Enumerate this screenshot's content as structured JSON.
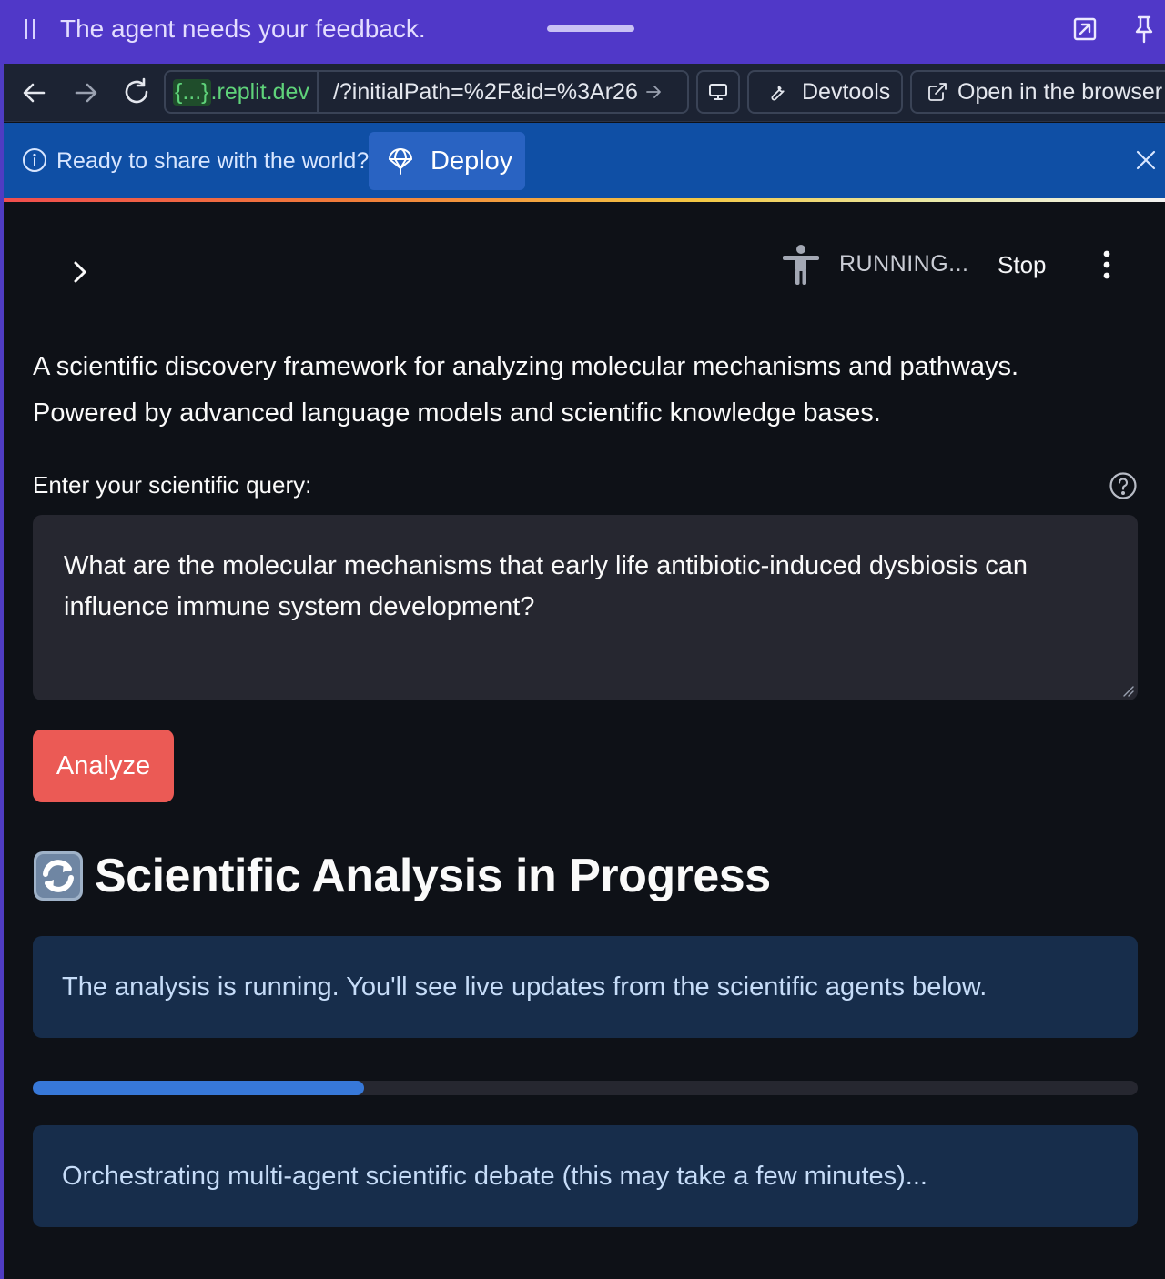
{
  "feedback_bar": {
    "message": "The agent needs your feedback."
  },
  "browser": {
    "url_braces": "{...}",
    "url_host": ".replit.dev",
    "url_path": "/?initialPath=%2F&id=%3Ar26",
    "devtools_label": "Devtools",
    "open_browser_label": "Open in the browser"
  },
  "deploy_banner": {
    "message": "Ready to share with the world?",
    "deploy_label": "Deploy"
  },
  "app": {
    "status": "RUNNING...",
    "stop_label": "Stop",
    "description_line1": "A scientific discovery framework for analyzing molecular mechanisms and pathways.",
    "description_line2": "Powered by advanced language models and scientific knowledge bases.",
    "query_label": "Enter your scientific query:",
    "query_value": "What are the molecular mechanisms that early life antibiotic-induced dysbiosis can influence immune system development?",
    "analyze_label": "Analyze",
    "progress_heading": "Scientific Analysis in Progress",
    "info_message": "The analysis is running. You'll see live updates from the scientific agents below.",
    "progress_fraction": 0.3,
    "status_message": "Orchestrating multi-agent scientific debate (this may take a few minutes)..."
  },
  "colors": {
    "feedback_bar": "#5038c8",
    "deploy_banner": "#0f4fa5",
    "app_background": "#0e1117",
    "analyze_button": "#eb5a55",
    "progress_fill": "#3778d8",
    "info_card": "#172d4b"
  },
  "icons": [
    "pause-icon",
    "popout-icon",
    "pin-icon",
    "back-icon",
    "forward-icon",
    "reload-icon",
    "arrow-right-icon",
    "monitor-icon",
    "wrench-icon",
    "external-link-icon",
    "info-icon",
    "deploy-icon",
    "close-icon",
    "chevron-right-icon",
    "accessibility-icon",
    "kebab-menu-icon",
    "help-icon",
    "refresh-icon"
  ]
}
